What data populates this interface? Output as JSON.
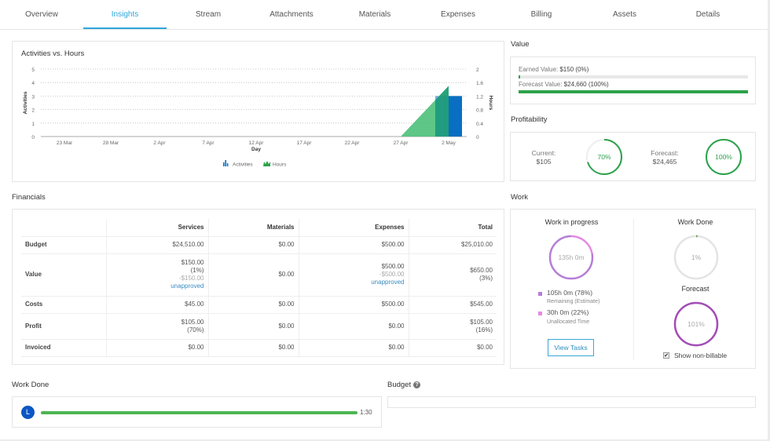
{
  "tabs": [
    {
      "label": "Overview",
      "active": false
    },
    {
      "label": "Insights",
      "active": true
    },
    {
      "label": "Stream",
      "active": false
    },
    {
      "label": "Attachments",
      "active": false
    },
    {
      "label": "Materials",
      "active": false
    },
    {
      "label": "Expenses",
      "active": false
    },
    {
      "label": "Billing",
      "active": false
    },
    {
      "label": "Assets",
      "active": false
    },
    {
      "label": "Details",
      "active": false
    }
  ],
  "chart_data": {
    "type": "bar",
    "title": "Activities vs. Hours",
    "xlabel": "Day",
    "ylabel": "Activities",
    "y2label": "Hours",
    "ylim": [
      0,
      5
    ],
    "y2lim": [
      0,
      2
    ],
    "yticks": [
      "0",
      "1",
      "2",
      "3",
      "4",
      "5"
    ],
    "y2ticks": [
      "0",
      "0.4",
      "0.8",
      "1.2",
      "1.6",
      "2"
    ],
    "xticks": [
      "23 Mar",
      "28 Mar",
      "2 Apr",
      "7 Apr",
      "12 Apr",
      "17 Apr",
      "22 Apr",
      "27 Apr",
      "2 May"
    ],
    "grid": true,
    "legend": "bottom-center",
    "series": [
      {
        "name": "Activities",
        "type": "bar",
        "color": "#0a6fc2",
        "points": [
          {
            "x": "1 May",
            "y": 3
          },
          {
            "x": "2 May",
            "y": 3
          }
        ]
      },
      {
        "name": "Hours",
        "type": "area",
        "color": "#4cc07a",
        "points": [
          {
            "x": "27 Apr",
            "y": 0
          },
          {
            "x": "2 May",
            "y": 1.5
          }
        ]
      }
    ]
  },
  "value": {
    "title": "Value",
    "earned_label": "Earned Value:",
    "earned_amount": "$150 (0%)",
    "earned_fraction": 0.006,
    "forecast_label": "Forecast Value:",
    "forecast_amount": "$24,660 (100%)",
    "forecast_fraction": 1.0,
    "bar_color": "#2ca24b"
  },
  "profitability": {
    "title": "Profitability",
    "current_label": "Current:",
    "current_amount": "$105",
    "current_percent_label": "70%",
    "current_percent": 70,
    "forecast_label": "Forecast:",
    "forecast_amount": "$24,465",
    "forecast_percent_label": "100%",
    "forecast_percent": 100,
    "color": "#2ca24b"
  },
  "financials": {
    "title": "Financials",
    "columns": [
      "",
      "Services",
      "Materials",
      "Expenses",
      "Total"
    ],
    "rows": [
      {
        "label": "Budget",
        "services": [
          "$24,510.00"
        ],
        "materials": [
          "$0.00"
        ],
        "expenses": [
          "$500.00"
        ],
        "total": [
          "$25,010.00"
        ]
      },
      {
        "label": "Value",
        "services": [
          "$150.00",
          "(1%)"
        ],
        "services_muted": "-$150.00",
        "services_link": "unapproved",
        "materials": [
          "$0.00"
        ],
        "expenses": [
          "$500.00"
        ],
        "expenses_muted": "-$500.00",
        "expenses_link": "unapproved",
        "total": [
          "$650.00",
          "(3%)"
        ]
      },
      {
        "label": "Costs",
        "services": [
          "$45.00"
        ],
        "materials": [
          "$0.00"
        ],
        "expenses": [
          "$500.00"
        ],
        "total": [
          "$545.00"
        ]
      },
      {
        "label": "Profit",
        "services": [
          "$105.00",
          "(70%)"
        ],
        "materials": [
          "$0.00"
        ],
        "expenses": [
          "$0.00"
        ],
        "total": [
          "$105.00",
          "(16%)"
        ]
      },
      {
        "label": "Invoiced",
        "services": [
          "$0.00"
        ],
        "materials": [
          "$0.00"
        ],
        "expenses": [
          "$0.00"
        ],
        "total": [
          "$0.00"
        ]
      }
    ]
  },
  "work": {
    "title": "Work",
    "wip_title": "Work in progress",
    "wip_total": "135h 0m",
    "remaining_value": "105h 0m (78%)",
    "remaining_label": "Remaining (Estimate)",
    "remaining_fraction": 0.78,
    "remaining_color": "#b57ed6",
    "unallocated_value": "30h 0m (22%)",
    "unallocated_label": "Unallocated Time",
    "unallocated_color": "#e48ae4",
    "view_tasks": "View Tasks",
    "done_title": "Work Done",
    "done_percent_label": "1%",
    "done_percent": 1,
    "forecast_title": "Forecast",
    "forecast_percent_label": "101%",
    "forecast_percent": 101,
    "forecast_color": "#a34db8",
    "show_nonbillable": "Show non-billable",
    "show_nonbillable_checked": true
  },
  "work_done": {
    "title": "Work Done",
    "rows": [
      {
        "initial": "L",
        "value": "1:30",
        "fraction": 1.0,
        "color": "#4db552"
      }
    ]
  },
  "budget": {
    "title": "Budget",
    "help": "?"
  }
}
